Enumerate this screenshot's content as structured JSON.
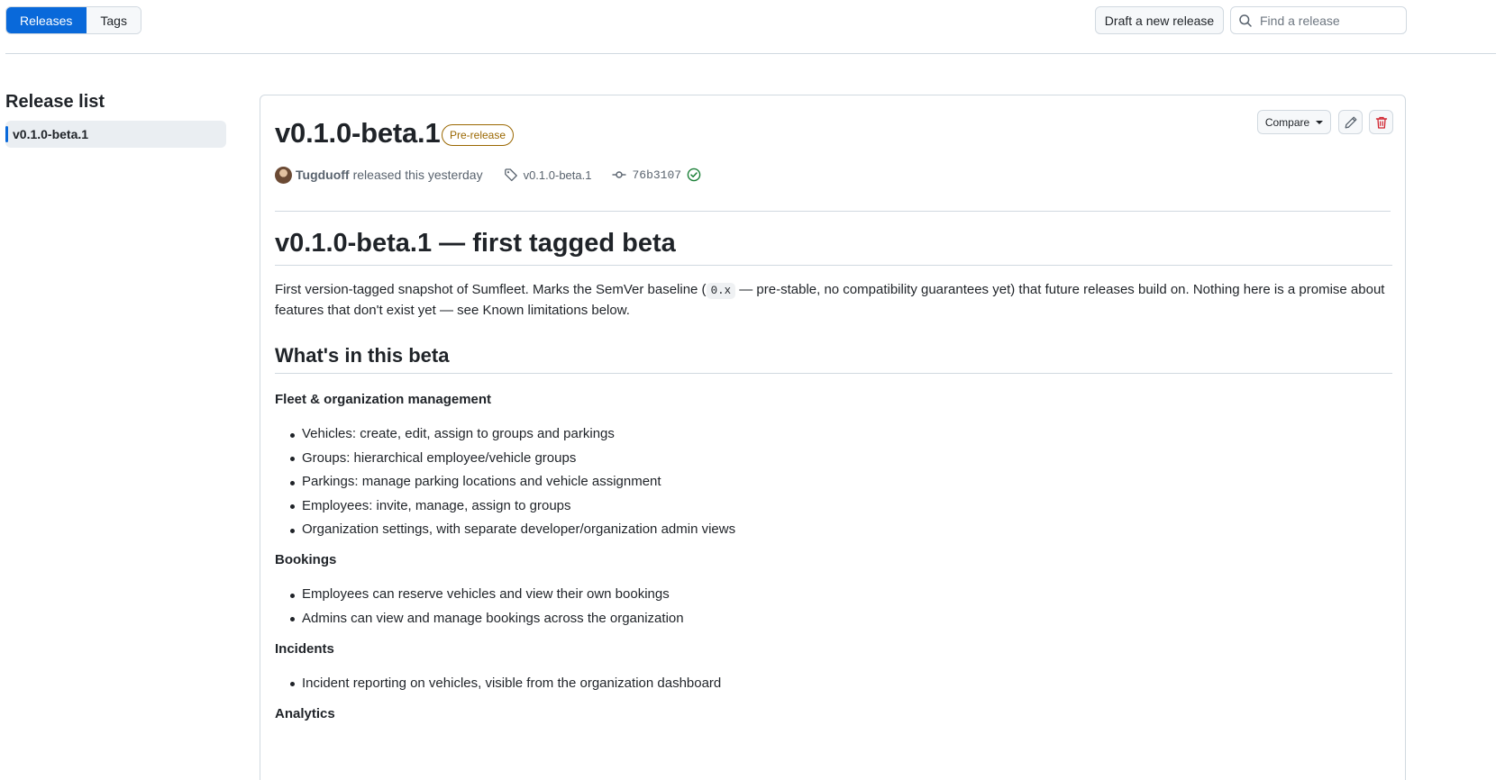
{
  "tabs": [
    {
      "label": "Releases",
      "active": true
    },
    {
      "label": "Tags",
      "active": false
    }
  ],
  "toolbar": {
    "draft_label": "Draft a new release",
    "search_placeholder": "Find a release"
  },
  "sidebar": {
    "title": "Release list",
    "items": [
      {
        "label": "v0.1.0-beta.1",
        "selected": true
      }
    ]
  },
  "release": {
    "title": "v0.1.0-beta.1",
    "badge": "Pre-release",
    "compare_label": "Compare",
    "author": "Tugduoff",
    "released_text": "released this yesterday",
    "tag": "v0.1.0-beta.1",
    "commit": "76b3107",
    "notes": {
      "heading": "v0.1.0-beta.1 — first tagged beta",
      "intro_before": "First version-tagged snapshot of Sumfleet. Marks the SemVer baseline (",
      "intro_code": "0.x",
      "intro_after": " — pre-stable, no compatibility guarantees yet) that future releases build on. Nothing here is a promise about features that don't exist yet — see Known limitations below.",
      "section_heading": "What's in this beta",
      "groups": [
        {
          "title": "Fleet & organization management",
          "items": [
            "Vehicles: create, edit, assign to groups and parkings",
            "Groups: hierarchical employee/vehicle groups",
            "Parkings: manage parking locations and vehicle assignment",
            "Employees: invite, manage, assign to groups",
            "Organization settings, with separate developer/organization admin views"
          ]
        },
        {
          "title": "Bookings",
          "items": [
            "Employees can reserve vehicles and view their own bookings",
            "Admins can view and manage bookings across the organization"
          ]
        },
        {
          "title": "Incidents",
          "items": [
            "Incident reporting on vehicles, visible from the organization dashboard"
          ]
        },
        {
          "title": "Analytics",
          "items": []
        }
      ]
    }
  },
  "colors": {
    "accent": "#0969da",
    "prerelease": "#9a6700",
    "success": "#1a7f37",
    "danger": "#d1242f"
  }
}
